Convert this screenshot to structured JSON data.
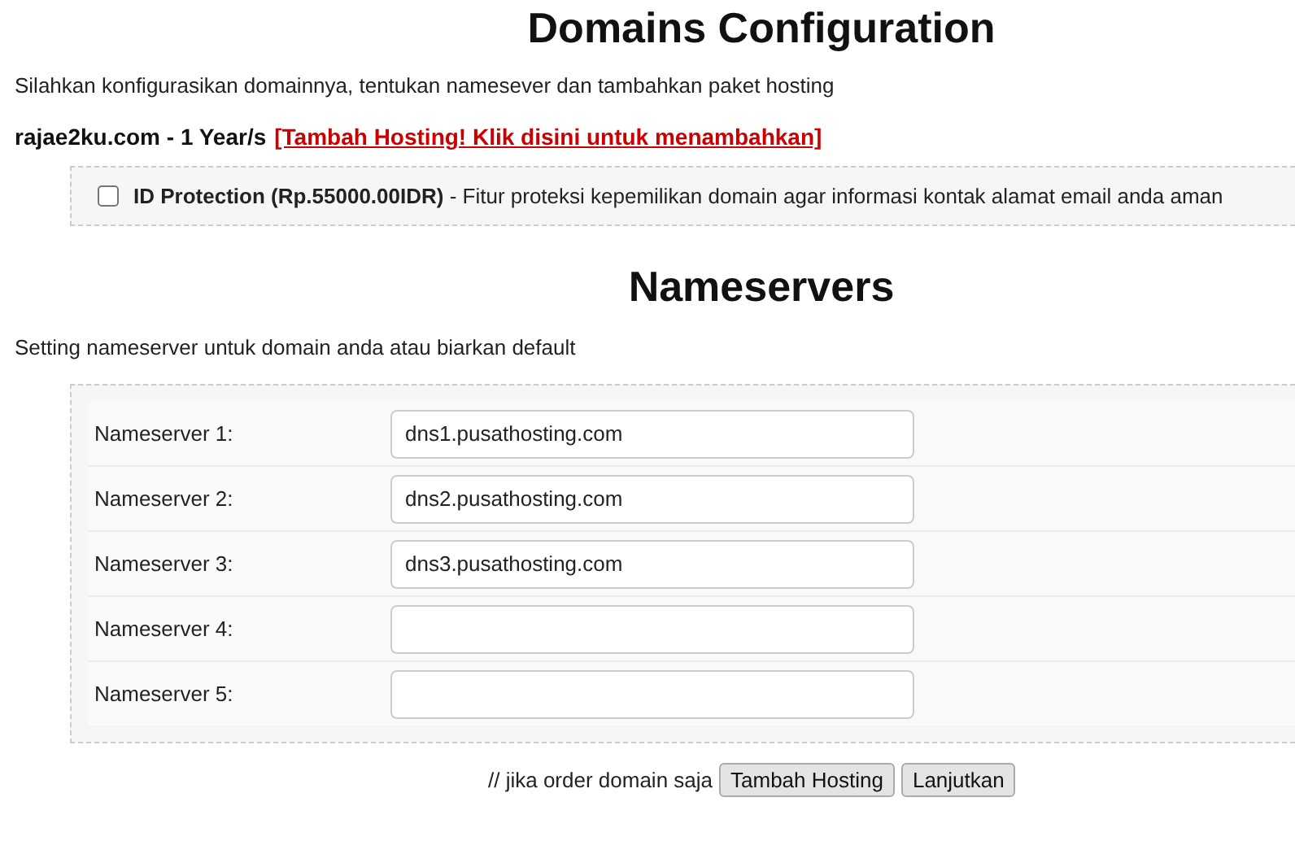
{
  "title": "Domains Configuration",
  "intro": "Silahkan konfigurasikan domainnya, tentukan namesever dan tambahkan paket hosting",
  "domain": {
    "name": "rajae2ku.com - 1 Year/s",
    "link": "[Tambah Hosting! Klik disini untuk menambahkan]"
  },
  "addons": [
    {
      "label": "**ID Protection (Rp.55000.00IDR)** - Fitur proteksi kepemilikan domain agar informasi kontak alamat email anda aman",
      "checked": false
    }
  ],
  "nameservers": {
    "title": "Nameservers",
    "intro": "Setting nameserver untuk domain anda atau biarkan default",
    "rows": [
      {
        "label": "Nameserver 1:",
        "value": "dns1.pusathosting.com"
      },
      {
        "label": "Nameserver 2:",
        "value": "dns2.pusathosting.com"
      },
      {
        "label": "Nameserver 3:",
        "value": "dns3.pusathosting.com"
      },
      {
        "label": "Nameserver 4:"
      },
      {
        "label": "Nameserver 5:"
      }
    ]
  },
  "footer": {
    "note": "// jika order domain saja",
    "buttons": [
      "Tambah Hosting",
      "Lanjutkan"
    ]
  }
}
